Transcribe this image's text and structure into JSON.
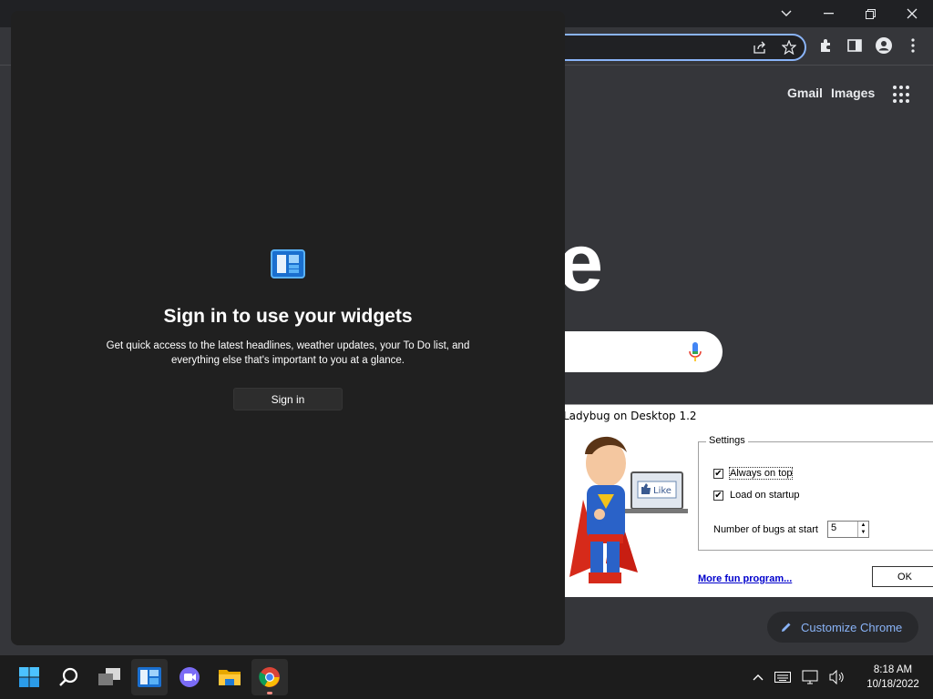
{
  "chrome": {
    "window_controls": [
      "chevron-down-icon",
      "minimize-icon",
      "restore-icon",
      "close-icon"
    ],
    "toolbar_icons": [
      "share-icon",
      "star-icon",
      "extensions-icon",
      "side-panel-icon",
      "profile-icon",
      "more-icon"
    ],
    "ntp": {
      "gmail_label": "Gmail",
      "images_label": "Images",
      "logo_fragment": "e",
      "customize_label": "Customize Chrome"
    }
  },
  "widgets": {
    "title": "Sign in to use your widgets",
    "description": "Get quick access to the latest headlines, weather updates, your To Do list, and everything else that's important to you at a glance.",
    "signin_label": "Sign in"
  },
  "ladybug": {
    "title": "Ladybug on Desktop 1.2",
    "art_like_label": "Like",
    "settings_label": "Settings",
    "always_on_top_label": "Always on top",
    "always_on_top_checked": true,
    "load_on_startup_label": "Load on startup",
    "load_on_startup_checked": true,
    "bugs_label": "Number of bugs at start",
    "bugs_value": "5",
    "more_link": "More fun program...",
    "ok_label": "OK"
  },
  "taskbar": {
    "apps": [
      "start-icon",
      "search-icon",
      "task-view-icon",
      "widgets-icon",
      "chat-icon",
      "file-explorer-icon",
      "chrome-icon"
    ],
    "time": "8:18 AM",
    "date": "10/18/2022"
  },
  "colors": {
    "accent": "#8ab4f8",
    "taskbar": "#1c1c1c",
    "widgets_bg": "#202020"
  }
}
